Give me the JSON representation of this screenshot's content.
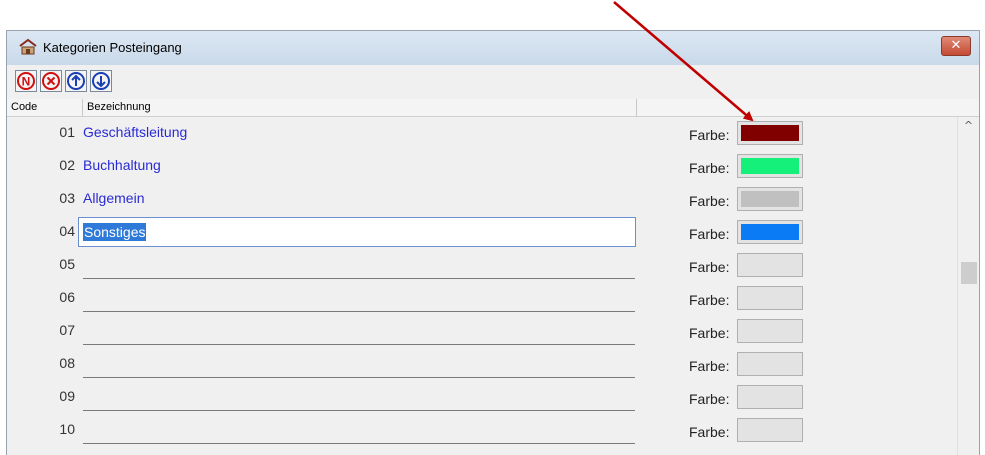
{
  "window": {
    "title": "Kategorien Posteingang"
  },
  "toolbar": {
    "buttons": [
      "new-icon",
      "delete-icon",
      "move-up-icon",
      "move-down-icon"
    ]
  },
  "header": {
    "code": "Code",
    "bezeichnung": "Bezeichnung"
  },
  "rows": [
    {
      "code": "01",
      "name": "Geschäftsleitung",
      "farbe_label": "Farbe:",
      "color": "#800000"
    },
    {
      "code": "02",
      "name": "Buchhaltung",
      "farbe_label": "Farbe:",
      "color": "#14f07a"
    },
    {
      "code": "03",
      "name": "Allgemein",
      "farbe_label": "Farbe:",
      "color": "#c0c0c0"
    },
    {
      "code": "04",
      "name": "Sonstiges",
      "farbe_label": "Farbe:",
      "color": "#0a7af5"
    },
    {
      "code": "05",
      "name": "",
      "farbe_label": "Farbe:",
      "color": ""
    },
    {
      "code": "06",
      "name": "",
      "farbe_label": "Farbe:",
      "color": ""
    },
    {
      "code": "07",
      "name": "",
      "farbe_label": "Farbe:",
      "color": ""
    },
    {
      "code": "08",
      "name": "",
      "farbe_label": "Farbe:",
      "color": ""
    },
    {
      "code": "09",
      "name": "",
      "farbe_label": "Farbe:",
      "color": ""
    },
    {
      "code": "10",
      "name": "",
      "farbe_label": "Farbe:",
      "color": ""
    }
  ],
  "colors": {
    "annotation_arrow": "#c00000",
    "title_bar": "#cfdcea",
    "toolbar_icon": "#d01010",
    "toolbar_icon_blue": "#1a3fb5"
  }
}
